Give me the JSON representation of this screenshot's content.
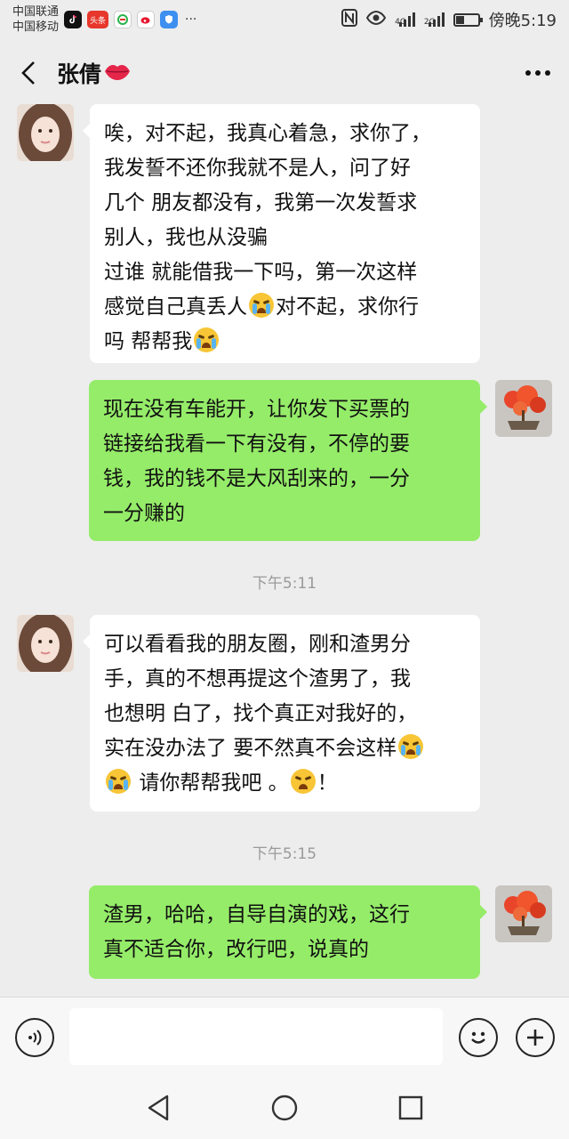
{
  "status_bar": {
    "carrier_1": "中国联通",
    "carrier_2": "中国移动",
    "apps": [
      "tiktok-icon",
      "toutiao-icon",
      "app-green-icon",
      "weibo-icon",
      "shield-app-icon"
    ],
    "toutiao_label": "头条",
    "overflow": "···",
    "network_1": "4G",
    "network_2": "2G",
    "time": "傍晚5:19"
  },
  "title_bar": {
    "contact_name": "张倩",
    "name_emoji": "lips-icon"
  },
  "messages": [
    {
      "side": "left",
      "lines": [
        "唉，对不起，我真心着急，求你了，",
        "我发誓不还你我就不是人，问了好",
        "几个 朋友都没有，我第一次发誓求",
        "别人，我也从没骗",
        "过谁 就能借我一下吗，第一次这样",
        "感觉自己真丢人",
        "对不起，求你行",
        "吗 帮帮我"
      ]
    },
    {
      "side": "right",
      "lines": [
        "现在没有车能开，让你发下买票的",
        "链接给我看一下有没有，不停的要",
        "钱，我的钱不是大风刮来的，一分",
        "一分赚的"
      ]
    },
    {
      "side": "left",
      "lines": [
        "可以看看我的朋友圈，刚和渣男分",
        "手，真的不想再提这个渣男了，我",
        "也想明 白了，找个真正对我好的，",
        "实在没办法了 要不然真不会这样",
        "请你帮帮我吧 。",
        "！"
      ]
    },
    {
      "side": "right",
      "lines": [
        "渣男，哈哈，自导自演的戏，这行",
        "真不适合你，改行吧，说真的"
      ]
    }
  ],
  "timestamps": [
    "下午5:11",
    "下午5:15"
  ],
  "input_bar": {
    "voice": "voice-icon",
    "emoji": "emoji-icon",
    "plus": "plus-icon",
    "value": ""
  },
  "nav_bar": {
    "back": "nav-back-icon",
    "home": "nav-home-icon",
    "recents": "nav-recents-icon"
  }
}
